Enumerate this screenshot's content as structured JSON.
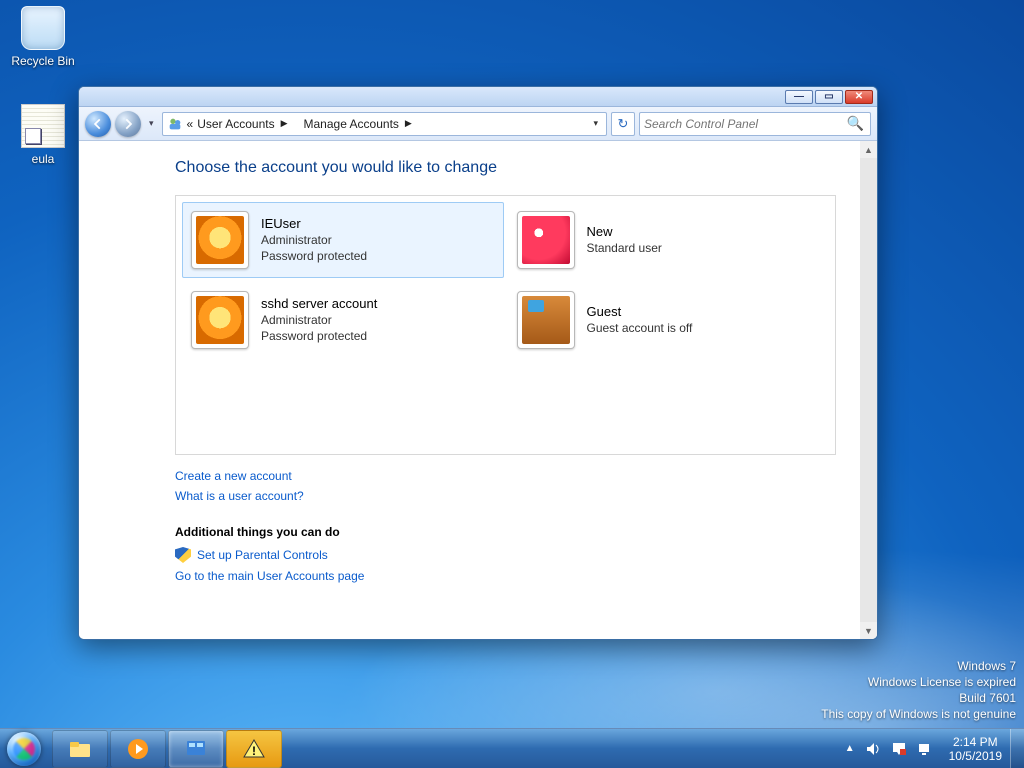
{
  "desktop": {
    "recycle_label": "Recycle Bin",
    "eula_label": "eula"
  },
  "watermark": {
    "l1": "Windows 7",
    "l2": "Windows License is expired",
    "l3": "Build 7601",
    "l4": "This copy of Windows is not genuine"
  },
  "taskbar": {
    "time": "2:14 PM",
    "date": "10/5/2019"
  },
  "window": {
    "breadcrumb": {
      "level0_prefix": "«",
      "level0": "User Accounts",
      "level1": "Manage Accounts"
    },
    "search_placeholder": "Search Control Panel",
    "page_title": "Choose the account you would like to change",
    "accounts": [
      {
        "name": "IEUser",
        "role": "Administrator",
        "extra": "Password protected",
        "avatar": "flower",
        "selected": true
      },
      {
        "name": "New",
        "role": "Standard user",
        "extra": "",
        "avatar": "red",
        "selected": false
      },
      {
        "name": "sshd server account",
        "role": "Administrator",
        "extra": "Password protected",
        "avatar": "flower",
        "selected": false
      },
      {
        "name": "Guest",
        "role": "Guest account is off",
        "extra": "",
        "avatar": "guest",
        "selected": false
      }
    ],
    "link_create": "Create a new account",
    "link_whatis": "What is a user account?",
    "additional_heading": "Additional things you can do",
    "link_parental": "Set up Parental Controls",
    "link_main": "Go to the main User Accounts page"
  }
}
